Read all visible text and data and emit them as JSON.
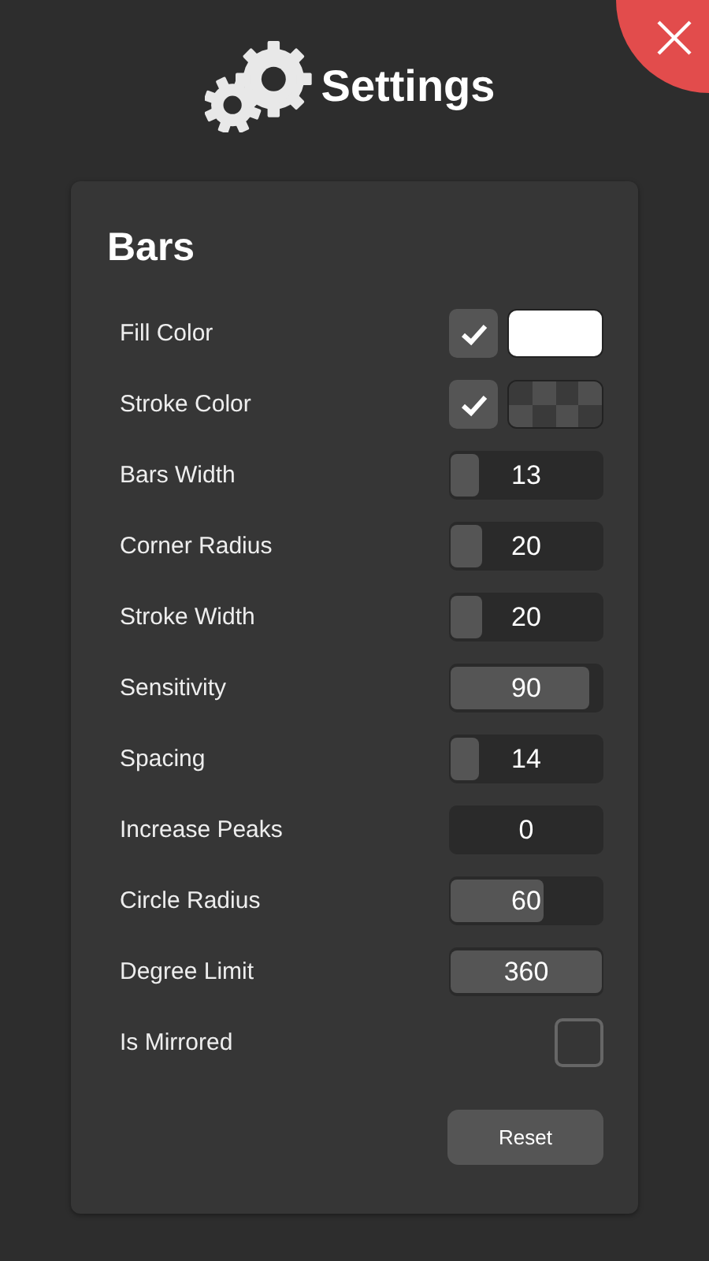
{
  "header": {
    "title": "Settings"
  },
  "panel": {
    "title": "Bars",
    "rows": [
      {
        "kind": "color",
        "label": "Fill Color",
        "checked": true,
        "color": "#ffffff"
      },
      {
        "kind": "color",
        "label": "Stroke Color",
        "checked": true,
        "transparent": true
      },
      {
        "kind": "slider",
        "label": "Bars Width",
        "level": 0.14,
        "value": "13"
      },
      {
        "kind": "slider",
        "label": "Corner Radius",
        "level": 0.2,
        "value": "20"
      },
      {
        "kind": "slider",
        "label": "Stroke Width",
        "level": 0.2,
        "value": "20"
      },
      {
        "kind": "slider",
        "label": "Sensitivity",
        "level": 0.9,
        "value": "90"
      },
      {
        "kind": "slider",
        "label": "Spacing",
        "level": 0.14,
        "value": "14"
      },
      {
        "kind": "number",
        "label": "Increase Peaks",
        "value": "0"
      },
      {
        "kind": "slider",
        "label": "Circle Radius",
        "level": 0.6,
        "value": "60"
      },
      {
        "kind": "slider",
        "label": "Degree Limit",
        "level": 1,
        "value": "360"
      },
      {
        "kind": "checkbox",
        "label": "Is Mirrored",
        "checked": false
      }
    ],
    "reset_button": "Reset"
  }
}
